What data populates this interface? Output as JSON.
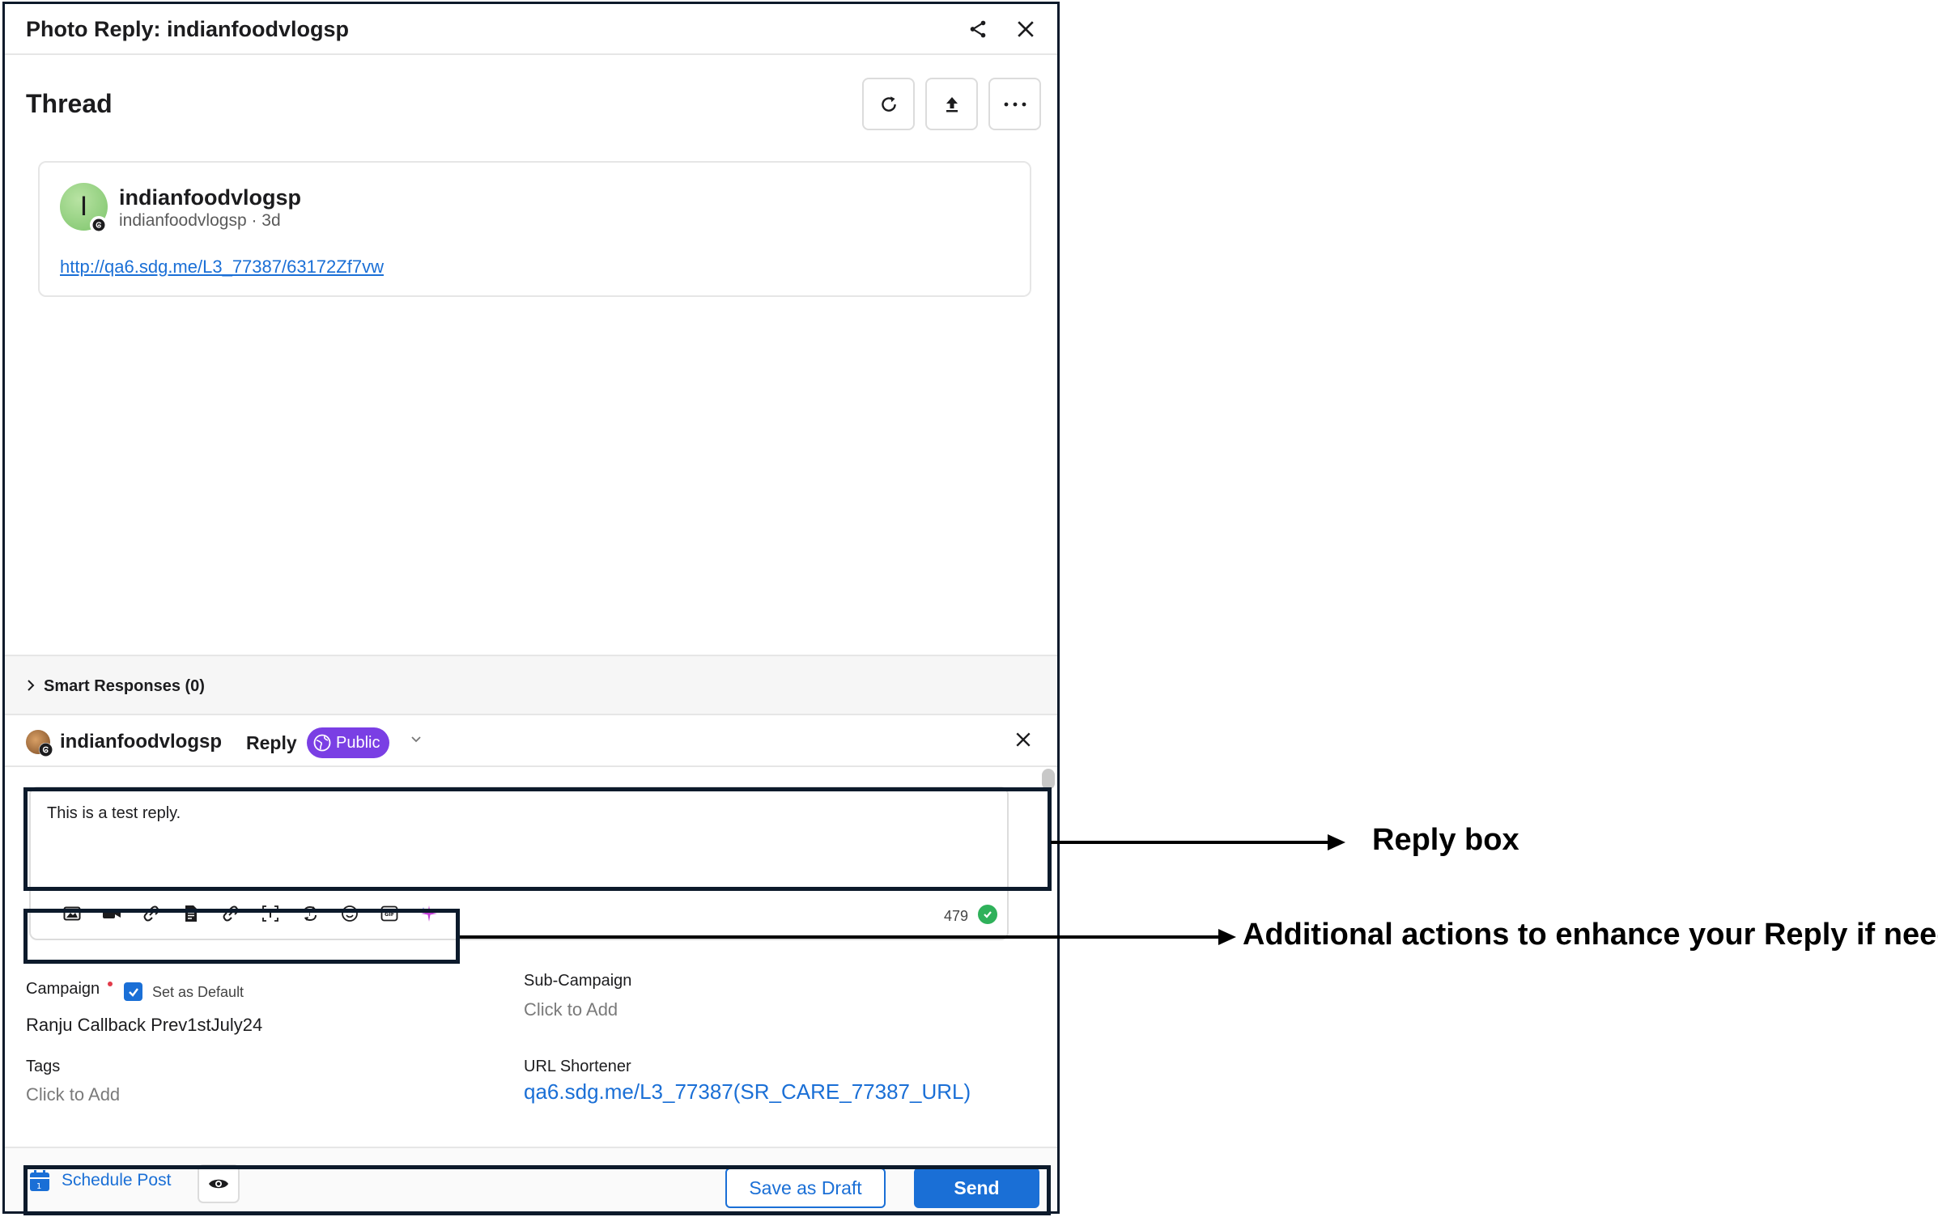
{
  "window": {
    "title": "Photo Reply: indianfoodvlogsp",
    "share_icon": "share-icon",
    "close_icon": "close-icon"
  },
  "thread": {
    "heading": "Thread",
    "actions": [
      "refresh-icon",
      "upload-icon",
      "more-icon"
    ],
    "message": {
      "avatar_letter": "I",
      "name": "indianfoodvlogsp",
      "meta": "indianfoodvlogsp · 3d",
      "link": "http://qa6.sdg.me/L3_77387/63172Zf7vw"
    }
  },
  "smart_responses": {
    "label": "Smart Responses (0)"
  },
  "reply": {
    "account": "indianfoodvlogsp",
    "label": "Reply",
    "visibility": "Public",
    "text": "This is a test reply.",
    "char_count": "479",
    "tools": [
      "image-icon",
      "video-icon",
      "link-icon",
      "document-icon",
      "link-icon",
      "text-icon",
      "repost-icon",
      "emoji-icon",
      "gif-icon",
      "ai-sparkle-icon"
    ]
  },
  "fields": {
    "campaign_label": "Campaign",
    "set_default_label": "Set as Default",
    "set_default_checked": true,
    "campaign_value": "Ranju Callback Prev1stJuly24",
    "subcampaign_label": "Sub-Campaign",
    "subcampaign_value": "Click to Add",
    "tags_label": "Tags",
    "tags_value": "Click to Add",
    "url_label": "URL Shortener",
    "url_value": "qa6.sdg.me/L3_77387(SR_CARE_77387_URL)"
  },
  "footer": {
    "schedule_label": "Schedule Post",
    "draft_label": "Save as Draft",
    "send_label": "Send"
  },
  "callouts": {
    "reply_box": "Reply box",
    "actions": "Additional actions to enhance your Reply if needed"
  },
  "colors": {
    "accent": "#1a6fd6",
    "public_pill": "#7a3fe4",
    "success": "#2fb15a",
    "required": "#e23b4a",
    "highlight_border": "#0c1a2b"
  }
}
